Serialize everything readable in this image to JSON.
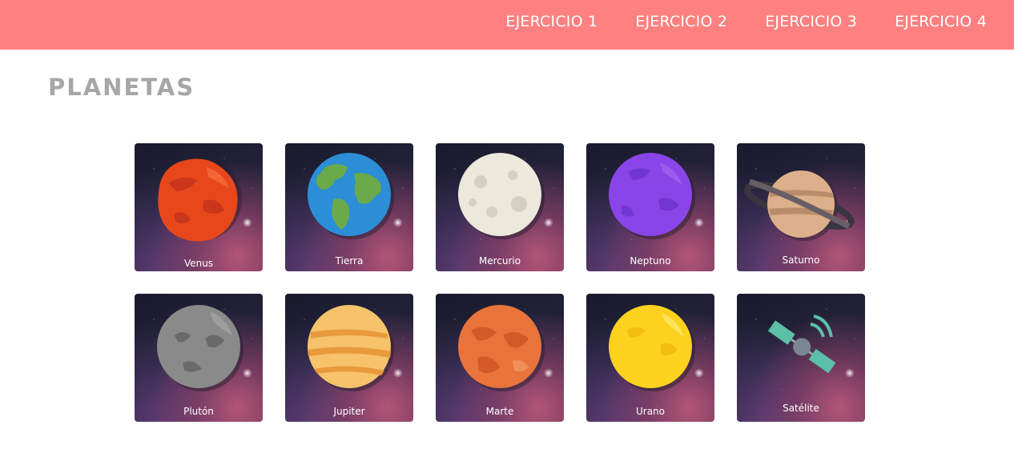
{
  "nav": {
    "items": [
      {
        "label": "EJERCICIO 1"
      },
      {
        "label": "EJERCICIO 2"
      },
      {
        "label": "EJERCICIO 3"
      },
      {
        "label": "EJERCICIO 4"
      }
    ]
  },
  "page": {
    "title": "PLANETAS"
  },
  "cards": [
    {
      "label": "Venus",
      "icon": "venus-planet-icon"
    },
    {
      "label": "Tierra",
      "icon": "earth-planet-icon"
    },
    {
      "label": "Mercurio",
      "icon": "mercury-planet-icon"
    },
    {
      "label": "Neptuno",
      "icon": "neptune-planet-icon"
    },
    {
      "label": "Saturno",
      "icon": "saturn-planet-icon"
    },
    {
      "label": "Plutón",
      "icon": "pluto-planet-icon"
    },
    {
      "label": "Jupiter",
      "icon": "jupiter-planet-icon"
    },
    {
      "label": "Marte",
      "icon": "mars-planet-icon"
    },
    {
      "label": "Urano",
      "icon": "uranus-planet-icon"
    },
    {
      "label": "Satélite",
      "icon": "satellite-icon"
    }
  ],
  "colors": {
    "topbar": "#ff8080",
    "title": "#a6a6a6",
    "venus": "#e8471c",
    "earth_ocean": "#2b8ed6",
    "earth_land": "#6aaa4a",
    "mercury": "#ece8dc",
    "neptune": "#8a45e8",
    "saturn": "#dcb08a",
    "pluto": "#8a8a8a",
    "jupiter": "#f6c26a",
    "mars": "#e8743c",
    "uranus": "#fdd21e",
    "satellite": "#5cbfa8"
  }
}
